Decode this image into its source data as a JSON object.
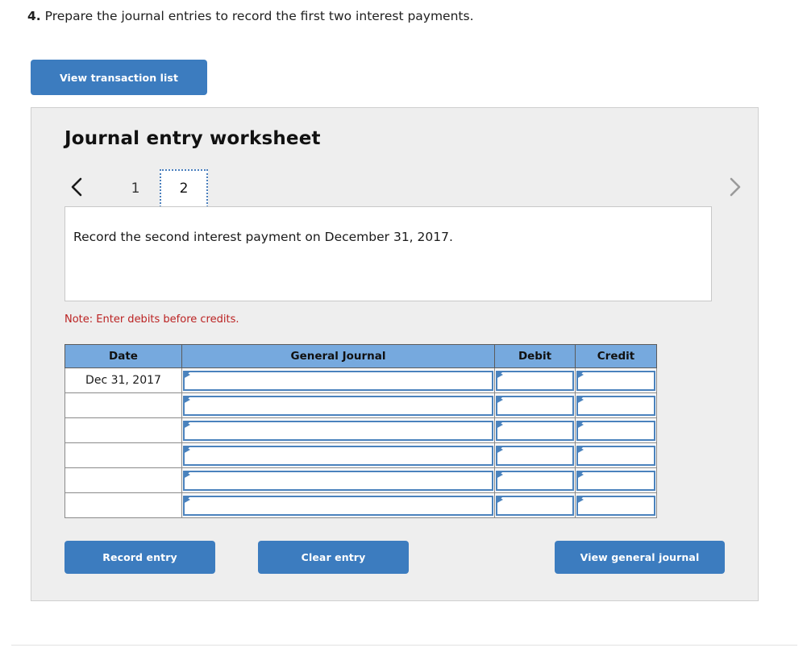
{
  "question": {
    "number": "4.",
    "text": "Prepare the journal entries to record the first two interest payments."
  },
  "toolbar": {
    "view_transaction_label": "View transaction list"
  },
  "panel": {
    "title": "Journal entry worksheet"
  },
  "tabs": {
    "prev_icon": "chevron-left-icon",
    "next_icon": "chevron-right-icon",
    "items": [
      {
        "label": "1",
        "active": false
      },
      {
        "label": "2",
        "active": true
      }
    ]
  },
  "instruction": {
    "text": "Record the second interest payment on December 31, 2017."
  },
  "note": {
    "text": "Note: Enter debits before credits."
  },
  "table": {
    "headers": [
      "Date",
      "General Journal",
      "Debit",
      "Credit"
    ],
    "rows": [
      {
        "date": "Dec 31, 2017",
        "general_journal": "",
        "debit": "",
        "credit": ""
      },
      {
        "date": "",
        "general_journal": "",
        "debit": "",
        "credit": ""
      },
      {
        "date": "",
        "general_journal": "",
        "debit": "",
        "credit": ""
      },
      {
        "date": "",
        "general_journal": "",
        "debit": "",
        "credit": ""
      },
      {
        "date": "",
        "general_journal": "",
        "debit": "",
        "credit": ""
      },
      {
        "date": "",
        "general_journal": "",
        "debit": "",
        "credit": ""
      }
    ]
  },
  "actions": {
    "record_label": "Record entry",
    "clear_label": "Clear entry",
    "view_journal_label": "View general journal"
  },
  "colors": {
    "button_blue": "#3c7cbf",
    "header_blue": "#76a9de",
    "field_border_blue": "#4a82bd",
    "note_red": "#bb2222",
    "panel_gray": "#eeeeee"
  }
}
